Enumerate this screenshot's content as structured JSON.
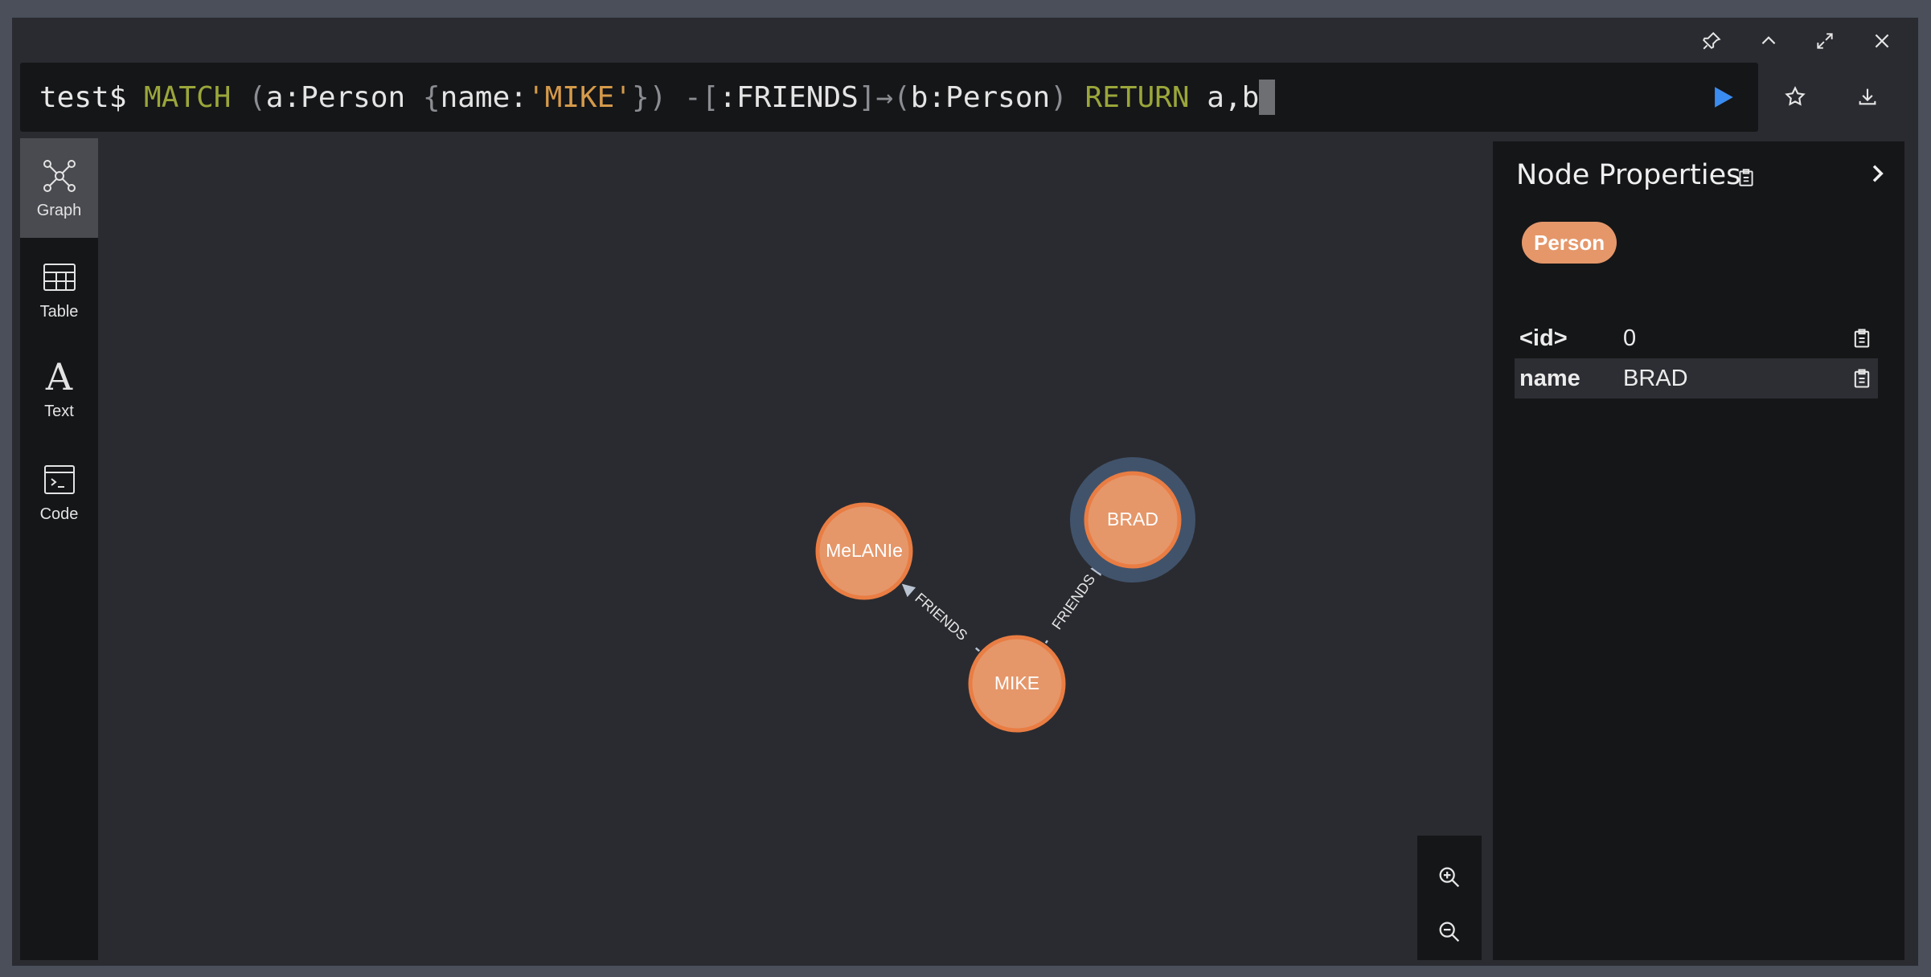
{
  "editor": {
    "prompt": "test$ ",
    "tokens": [
      {
        "t": "MATCH",
        "c": "kw"
      },
      {
        "t": " ",
        "c": "ident"
      },
      {
        "t": "(",
        "c": "paren"
      },
      {
        "t": "a:Person ",
        "c": "ident"
      },
      {
        "t": "{",
        "c": "paren"
      },
      {
        "t": "name:",
        "c": "ident"
      },
      {
        "t": "'MIKE'",
        "c": "str"
      },
      {
        "t": "})",
        "c": "paren"
      },
      {
        "t": " -[",
        "c": "paren"
      },
      {
        "t": ":FRIENDS",
        "c": "ident"
      },
      {
        "t": "]→(",
        "c": "paren"
      },
      {
        "t": "b:Person",
        "c": "ident"
      },
      {
        "t": ")",
        "c": "paren"
      },
      {
        "t": " RETURN",
        "c": "kw"
      },
      {
        "t": " a,b",
        "c": "ident"
      }
    ]
  },
  "window_controls": [
    "pin-icon",
    "chevron-up-icon",
    "expand-icon",
    "close-icon"
  ],
  "actions": [
    "run-icon",
    "star-icon",
    "download-icon"
  ],
  "views": [
    {
      "label": "Graph",
      "icon": "graph-icon",
      "active": true
    },
    {
      "label": "Table",
      "icon": "table-icon",
      "active": false
    },
    {
      "label": "Text",
      "icon": "text-icon",
      "active": false
    },
    {
      "label": "Code",
      "icon": "code-icon",
      "active": false
    }
  ],
  "graph": {
    "nodes": [
      {
        "id": "melanie",
        "label": "MeLANIe",
        "selected": false
      },
      {
        "id": "brad",
        "label": "BRAD",
        "selected": true
      },
      {
        "id": "mike",
        "label": "MIKE",
        "selected": false
      }
    ],
    "edges": [
      {
        "from": "mike",
        "to": "melanie",
        "label": "FRIENDS"
      },
      {
        "from": "mike",
        "to": "brad",
        "label": "FRIENDS"
      }
    ],
    "node_color": "#e5976a",
    "node_border": "#e97d43",
    "selection_ring": "#41536b",
    "zoom_controls": [
      "zoom-in-icon",
      "zoom-out-icon"
    ]
  },
  "properties": {
    "title": "Node Properties",
    "label": "Person",
    "rows": [
      {
        "key": "<id>",
        "value": "0"
      },
      {
        "key": "name",
        "value": "BRAD"
      }
    ]
  }
}
